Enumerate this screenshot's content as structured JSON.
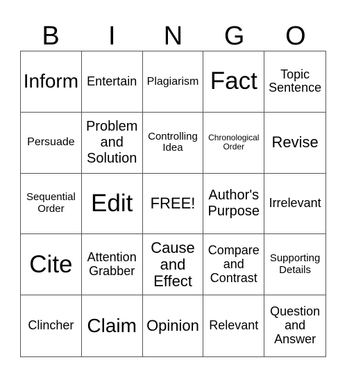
{
  "header": [
    "B",
    "I",
    "N",
    "G",
    "O"
  ],
  "cells": [
    {
      "text": "Inform",
      "size": "s-lg"
    },
    {
      "text": "Entertain",
      "size": "s-ms"
    },
    {
      "text": "Plagiarism",
      "size": "s-s"
    },
    {
      "text": "Fact",
      "size": "s-xl"
    },
    {
      "text": "Topic Sentence",
      "size": "s-ms"
    },
    {
      "text": "Persuade",
      "size": "s-s"
    },
    {
      "text": "Problem and Solution",
      "size": "s-m"
    },
    {
      "text": "Controlling Idea",
      "size": "s-xs"
    },
    {
      "text": "Chronological Order",
      "size": "s-xxs"
    },
    {
      "text": "Revise",
      "size": "s-ml"
    },
    {
      "text": "Sequential Order",
      "size": "s-xs"
    },
    {
      "text": "Edit",
      "size": "s-xl"
    },
    {
      "text": "FREE!",
      "size": "s-ml"
    },
    {
      "text": "Author's Purpose",
      "size": "s-m"
    },
    {
      "text": "Irrelevant",
      "size": "s-ms"
    },
    {
      "text": "Cite",
      "size": "s-xl"
    },
    {
      "text": "Attention Grabber",
      "size": "s-ms"
    },
    {
      "text": "Cause and Effect",
      "size": "s-ml"
    },
    {
      "text": "Compare and Contrast",
      "size": "s-ms"
    },
    {
      "text": "Supporting Details",
      "size": "s-xs"
    },
    {
      "text": "Clincher",
      "size": "s-ms"
    },
    {
      "text": "Claim",
      "size": "s-lg"
    },
    {
      "text": "Opinion",
      "size": "s-ml"
    },
    {
      "text": "Relevant",
      "size": "s-ms"
    },
    {
      "text": "Question and Answer",
      "size": "s-ms"
    }
  ]
}
